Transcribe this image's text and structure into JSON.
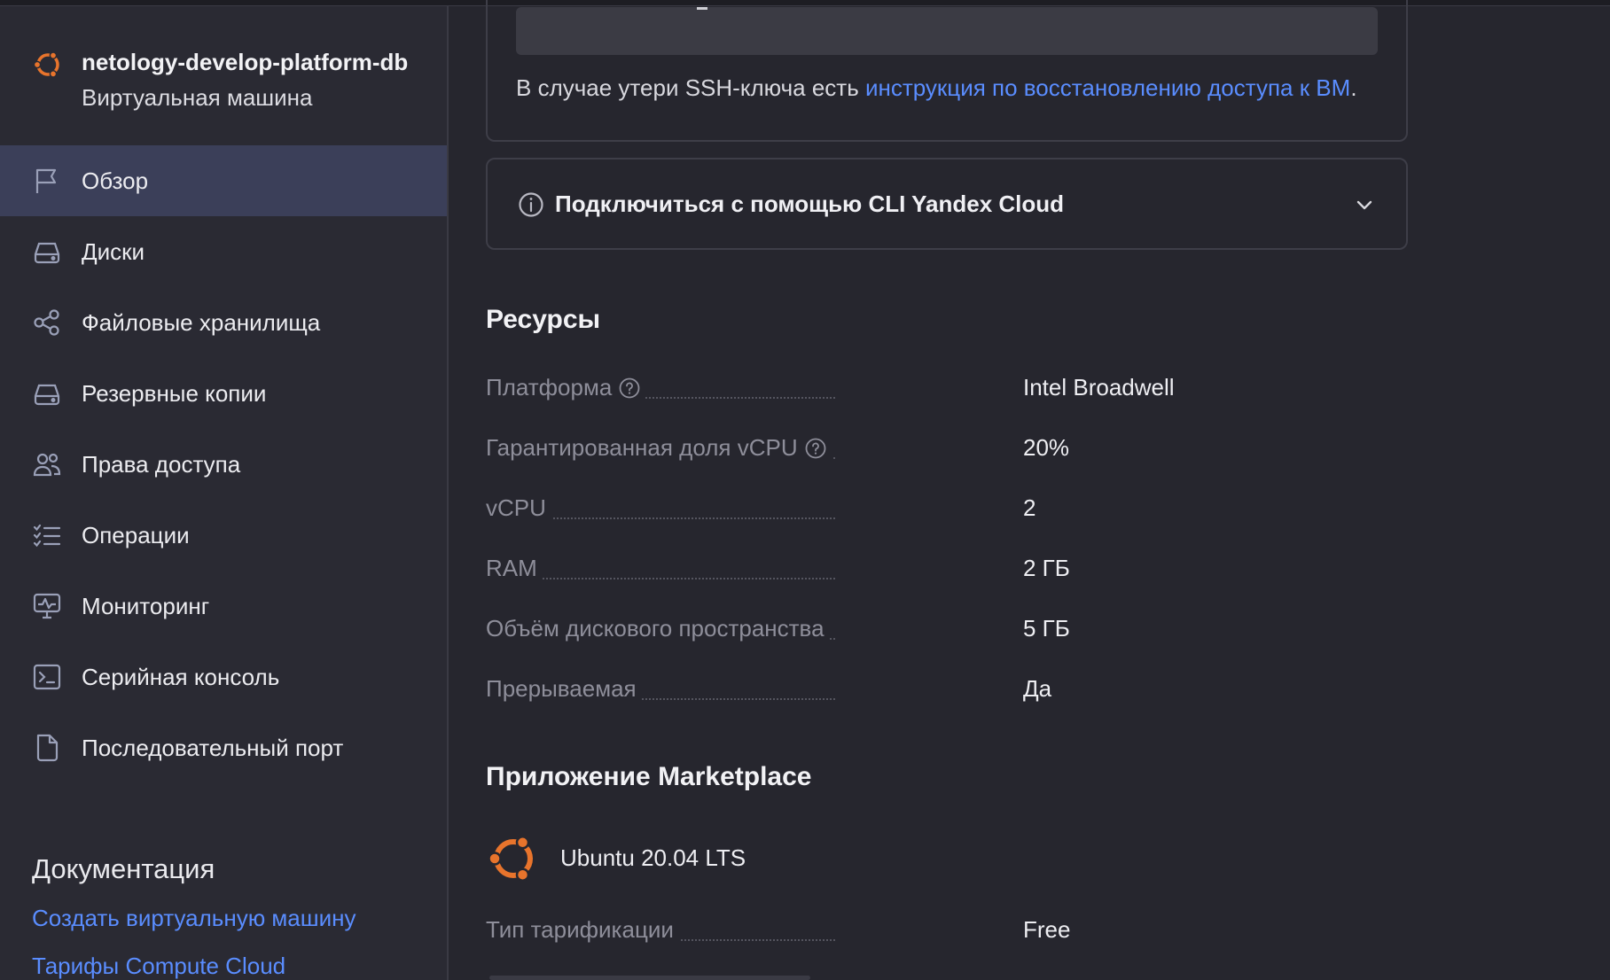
{
  "sidebar": {
    "vm_name": "netology-develop-platform-db",
    "vm_type": "Виртуальная машина",
    "items": [
      {
        "label": "Обзор",
        "icon": "flag-icon",
        "active": true
      },
      {
        "label": "Диски",
        "icon": "disk-icon"
      },
      {
        "label": "Файловые хранилища",
        "icon": "share-icon"
      },
      {
        "label": "Резервные копии",
        "icon": "backup-icon"
      },
      {
        "label": "Права доступа",
        "icon": "users-icon"
      },
      {
        "label": "Операции",
        "icon": "list-icon"
      },
      {
        "label": "Мониторинг",
        "icon": "monitor-icon"
      },
      {
        "label": "Серийная консоль",
        "icon": "terminal-icon"
      },
      {
        "label": "Последовательный порт",
        "icon": "file-icon"
      }
    ],
    "docs": {
      "title": "Документация",
      "links": [
        "Создать виртуальную машину",
        "Тарифы Compute Cloud"
      ]
    }
  },
  "main": {
    "ssh_note_prefix": "В случае утери SSH-ключа есть ",
    "ssh_note_link": "инструкция по восстановлению доступа к ВМ",
    "ssh_note_suffix": ".",
    "cli_connect_label": "Подключиться с помощью CLI Yandex Cloud",
    "resources": {
      "title": "Ресурсы",
      "rows": [
        {
          "key": "Платформа",
          "value": "Intel Broadwell",
          "help": true
        },
        {
          "key": "Гарантированная доля vCPU",
          "value": "20%",
          "help": true
        },
        {
          "key": "vCPU",
          "value": "2"
        },
        {
          "key": "RAM",
          "value": "2 ГБ"
        },
        {
          "key": "Объём дискового пространства",
          "value": "5 ГБ"
        },
        {
          "key": "Прерываемая",
          "value": "Да"
        }
      ]
    },
    "marketplace": {
      "title": "Приложение Marketplace",
      "app_name": "Ubuntu 20.04 LTS",
      "billing_key": "Тип тарификации",
      "billing_value": "Free"
    }
  },
  "colors": {
    "accent": "#5a8dff",
    "active_bg": "#3b3f59",
    "brand_orange": "#e8742c"
  }
}
